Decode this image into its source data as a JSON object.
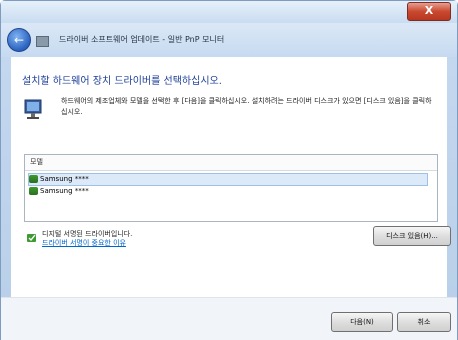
{
  "window": {
    "close_glyph": "X"
  },
  "nav": {
    "back_glyph": "←",
    "title": "드라이버 소프트웨어 업데이트 - 일반 PnP 모니터"
  },
  "content": {
    "heading": "설치할 하드웨어 장치 드라이버를 선택하십시오.",
    "instruction": "하드웨어의 제조업체와 모델을 선택한 후 [다음]을 클릭하십시오. 설치하려는 드라이버 디스크가 있으면 [디스크 있음]을 클릭하십시오.",
    "list": {
      "header": "모델",
      "items": [
        "Samsung ****",
        "Samsung ****"
      ]
    },
    "signed_text": "디지털 서명된 드라이버입니다.",
    "signed_link": "드라이버 서명이 중요한 이유",
    "disk_button": "디스크 있음(H)..."
  },
  "footer": {
    "next_button": "다음(N)",
    "cancel_button": "취소"
  }
}
